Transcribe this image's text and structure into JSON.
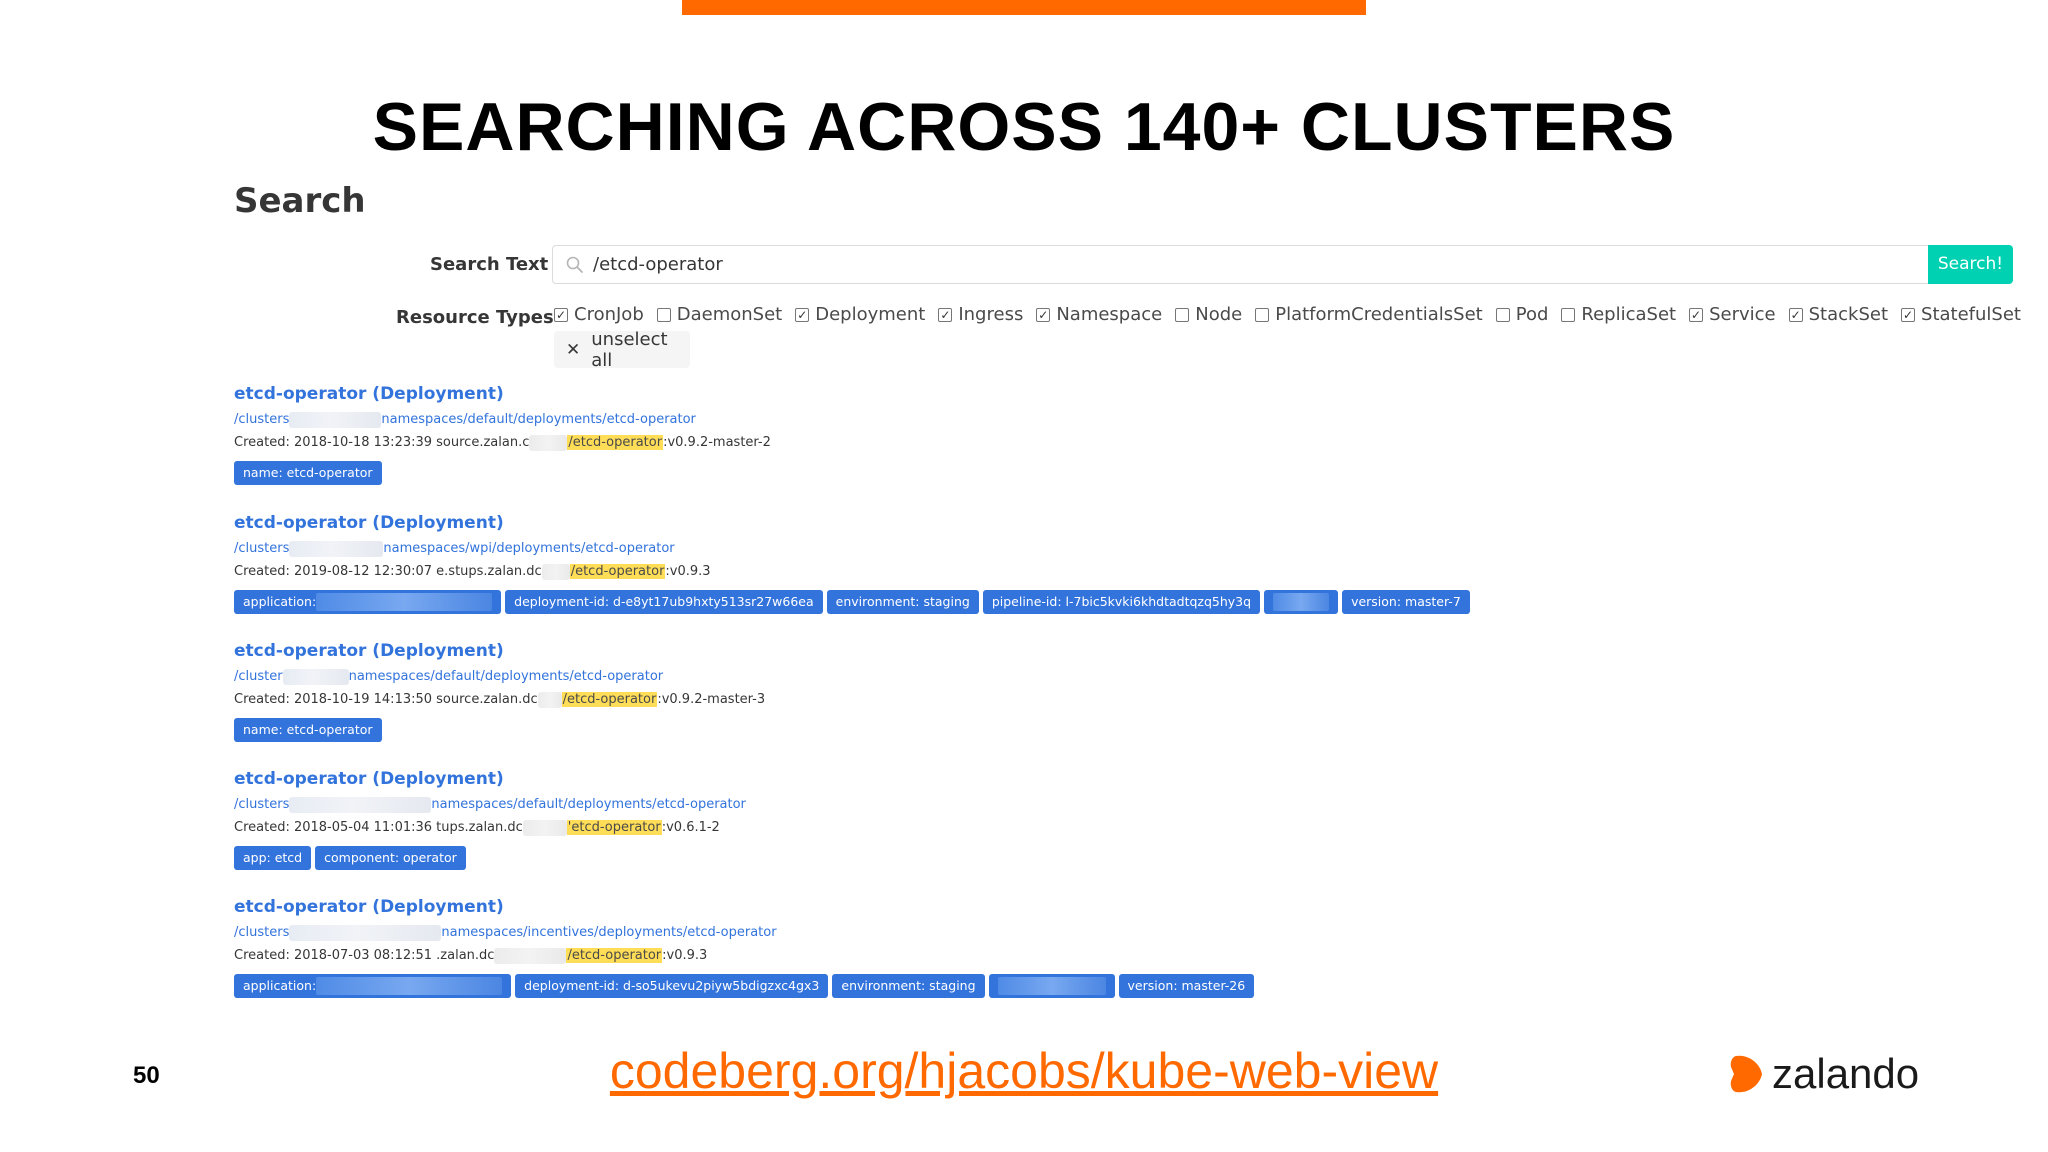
{
  "slide": {
    "title": "SEARCHING ACROSS 140+ CLUSTERS",
    "page_number": "50",
    "link": "codeberg.org/hjacobs/kube-web-view",
    "brand": "zalando",
    "accent_color": "#ff6900"
  },
  "search": {
    "heading": "Search",
    "search_text_label": "Search Text",
    "search_value": "/etcd-operator",
    "search_button": "Search!",
    "resource_types_label": "Resource Types",
    "resource_types": [
      {
        "label": "CronJob",
        "checked": true
      },
      {
        "label": "DaemonSet",
        "checked": false
      },
      {
        "label": "Deployment",
        "checked": true
      },
      {
        "label": "Ingress",
        "checked": true
      },
      {
        "label": "Namespace",
        "checked": true
      },
      {
        "label": "Node",
        "checked": false
      },
      {
        "label": "PlatformCredentialsSet",
        "checked": false
      },
      {
        "label": "Pod",
        "checked": false
      },
      {
        "label": "ReplicaSet",
        "checked": false
      },
      {
        "label": "Service",
        "checked": true
      },
      {
        "label": "StackSet",
        "checked": true
      },
      {
        "label": "StatefulSet",
        "checked": true
      }
    ],
    "unselect_all": "unselect all",
    "button_color": "#00d1b2",
    "link_color": "#3273dc",
    "highlight_color": "#ffdd57"
  },
  "results": [
    {
      "title": "etcd-operator (Deployment)",
      "path_prefix": "/clusters",
      "path_suffix": "namespaces/default/deployments/etcd-operator",
      "created_prefix": "Created: 2018-10-18 13:23:39 source.zalan.c",
      "match": "/etcd-operator",
      "version": ":v0.9.2-master-2",
      "tags": [
        "name: etcd-operator"
      ]
    },
    {
      "title": "etcd-operator (Deployment)",
      "path_prefix": "/clusters",
      "path_suffix": "namespaces/wpi/deployments/etcd-operator",
      "created_prefix": "Created: 2019-08-12 12:30:07 e.stups.zalan.dc",
      "match": "/etcd-operator",
      "version": ":v0.9.3",
      "tags": [
        "application:",
        "deployment-id: d-e8yt17ub9hxty513sr27w66ea",
        "environment: staging",
        "pipeline-id: l-7bic5kvki6khdtadtqzq5hy3q",
        "",
        "version: master-7"
      ]
    },
    {
      "title": "etcd-operator (Deployment)",
      "path_prefix": "/cluster",
      "path_suffix": "namespaces/default/deployments/etcd-operator",
      "created_prefix": "Created: 2018-10-19 14:13:50 source.zalan.dc",
      "match": "/etcd-operator",
      "version": ":v0.9.2-master-3",
      "tags": [
        "name: etcd-operator"
      ]
    },
    {
      "title": "etcd-operator (Deployment)",
      "path_prefix": "/clusters",
      "path_suffix": "namespaces/default/deployments/etcd-operator",
      "created_prefix": "Created: 2018-05-04 11:01:36 tups.zalan.dc",
      "match": "'etcd-operator",
      "version": ":v0.6.1-2",
      "tags": [
        "app: etcd",
        "component: operator"
      ]
    },
    {
      "title": "etcd-operator (Deployment)",
      "path_prefix": "/clusters",
      "path_suffix": "namespaces/incentives/deployments/etcd-operator",
      "created_prefix": "Created: 2018-07-03 08:12:51 .zalan.dc",
      "match": "/etcd-operator",
      "version": ":v0.9.3",
      "tags": [
        "application:",
        "deployment-id: d-so5ukevu2piyw5bdigzxc4gx3",
        "environment: staging",
        "",
        "version: master-26"
      ]
    }
  ]
}
